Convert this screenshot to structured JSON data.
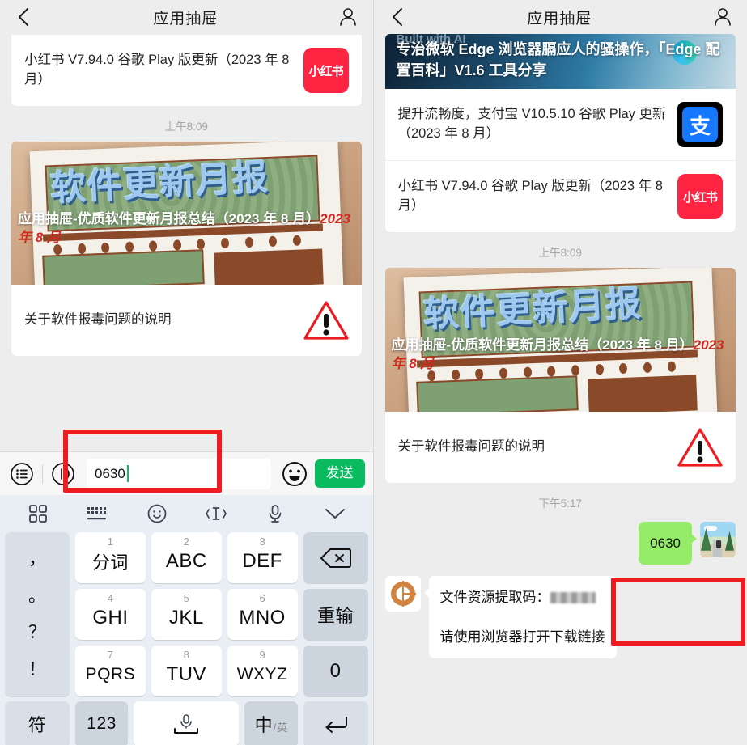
{
  "app": {
    "nav_title": "应用抽屉",
    "back_icon": "chevron-left-icon",
    "profile_icon": "person-icon"
  },
  "left_panel": {
    "article_card_top": {
      "rows": [
        {
          "text": "小红书 V7.94.0 谷歌 Play 版更新（2023 年 8 月）",
          "thumb": "xiaohongshu-icon",
          "thumb_label": "小红书"
        }
      ]
    },
    "timestamp": "上午8:09",
    "feature_card": {
      "hero_text": "软件更新月报",
      "overlay_title": "应用抽屉-优质软件更新月报总结（2023 年 8 月）",
      "overlay_stamp": "2023 年 8 月",
      "row_text": "关于软件报毒问题的说明",
      "row_icon": "warning-triangle-icon"
    },
    "input_bar": {
      "menu_icon": "list-circle-icon",
      "voice_icon": "voice-circle-icon",
      "value": "0630",
      "placeholder": "",
      "emoji_icon": "smiley-icon",
      "send_label": "发送",
      "send_color": "#09bb5e"
    },
    "keyboard": {
      "toolbar": [
        {
          "icon": "apps-grid-icon"
        },
        {
          "icon": "keyboard-icon"
        },
        {
          "icon": "emoji-smiley-icon"
        },
        {
          "icon": "text-cursor-icon"
        },
        {
          "icon": "microphone-icon"
        },
        {
          "icon": "chevron-down-icon"
        }
      ],
      "punctuation": [
        "，",
        "。",
        "？",
        "！"
      ],
      "keys": [
        {
          "num": "1",
          "label": "分词"
        },
        {
          "num": "2",
          "label": "ABC"
        },
        {
          "num": "3",
          "label": "DEF"
        },
        {
          "num": "4",
          "label": "GHI"
        },
        {
          "num": "5",
          "label": "JKL"
        },
        {
          "num": "6",
          "label": "MNO"
        },
        {
          "num": "7",
          "label": "PQRS"
        },
        {
          "num": "8",
          "label": "TUV"
        },
        {
          "num": "9",
          "label": "WXYZ"
        }
      ],
      "backspace_icon": "backspace-icon",
      "redo_label": "重输",
      "zero_label": "0",
      "symbol_label": "符",
      "numeric_label": "123",
      "space_icon": "microphone-space-icon",
      "lang_cn": "中",
      "lang_sep": "/",
      "lang_en": "英",
      "enter_icon": "enter-arrow-icon"
    }
  },
  "right_panel": {
    "banner": {
      "sub": "Built with AI",
      "title": "专治微软 Edge 浏览器膈应人的骚操作，「Edge 配置百科」V1.6 工具分享",
      "logo_icon": "edge-browser-icon"
    },
    "article_card": {
      "rows": [
        {
          "text": "提升流畅度，支付宝 V10.5.10 谷歌 Play 更新（2023 年 8 月）",
          "thumb": "alipay-icon",
          "thumb_label": "支"
        },
        {
          "text": "小红书 V7.94.0 谷歌 Play 版更新（2023 年 8 月）",
          "thumb": "xiaohongshu-icon",
          "thumb_label": "小红书"
        }
      ]
    },
    "timestamp_morning": "上午8:09",
    "feature_card": {
      "hero_text": "软件更新月报",
      "overlay_title": "应用抽屉-优质软件更新月报总结（2023 年 8 月）",
      "overlay_stamp": "2023 年 8 月",
      "row_text": "关于软件报毒问题的说明",
      "row_icon": "warning-triangle-icon"
    },
    "timestamp_afternoon": "下午5:17",
    "sent_message": {
      "text": "0630",
      "bubble_color": "#95ec69",
      "avatar_icon": "user-scenery-avatar"
    },
    "received_message": {
      "line1_label": "文件资源提取码：",
      "line1_redacted": true,
      "line2": "请使用浏览器打开下载链接",
      "avatar_icon": "app-drawer-logo-avatar",
      "avatar_color": "#d2833f"
    }
  },
  "annotations": [
    {
      "name": "input-highlight",
      "color": "#ee1c21"
    },
    {
      "name": "sent-bubble-highlight",
      "color": "#ee1c21"
    }
  ]
}
